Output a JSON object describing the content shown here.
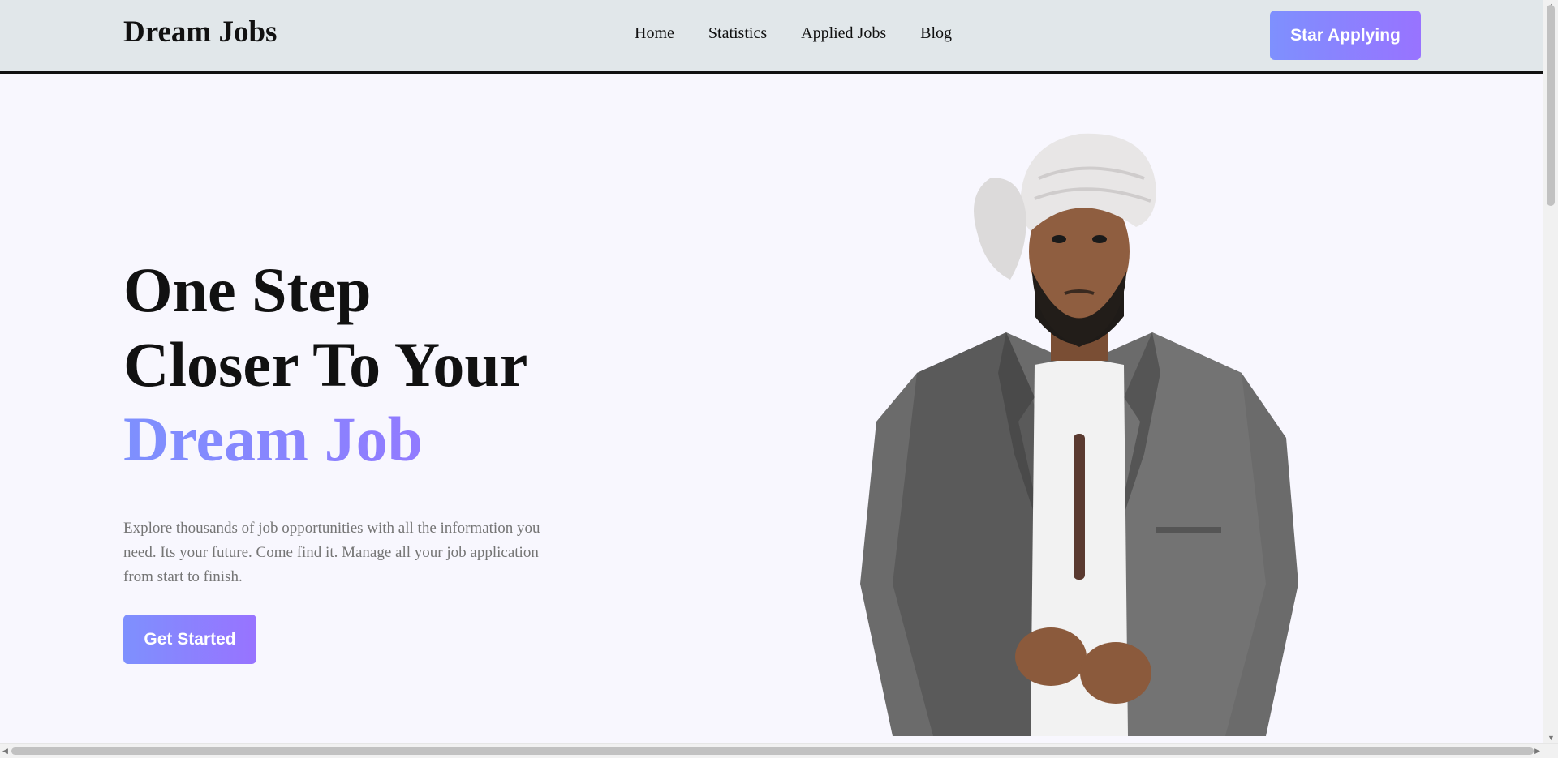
{
  "navbar": {
    "logo": "Dream Jobs",
    "links": [
      {
        "label": "Home"
      },
      {
        "label": "Statistics"
      },
      {
        "label": "Applied Jobs"
      },
      {
        "label": "Blog"
      }
    ],
    "cta_label": "Star Applying"
  },
  "hero": {
    "title_line1": "One Step",
    "title_line2": "Closer To Your",
    "title_accent": "Dream Job",
    "description": "Explore thousands of job opportunities with all the information you need. Its your future. Come find it. Manage all your job application from start to finish.",
    "cta_label": "Get Started"
  },
  "colors": {
    "accent_start": "#7e90fe",
    "accent_end": "#9873ff",
    "navbar_bg": "#e1e7ea",
    "page_bg": "#f8f7fe"
  }
}
